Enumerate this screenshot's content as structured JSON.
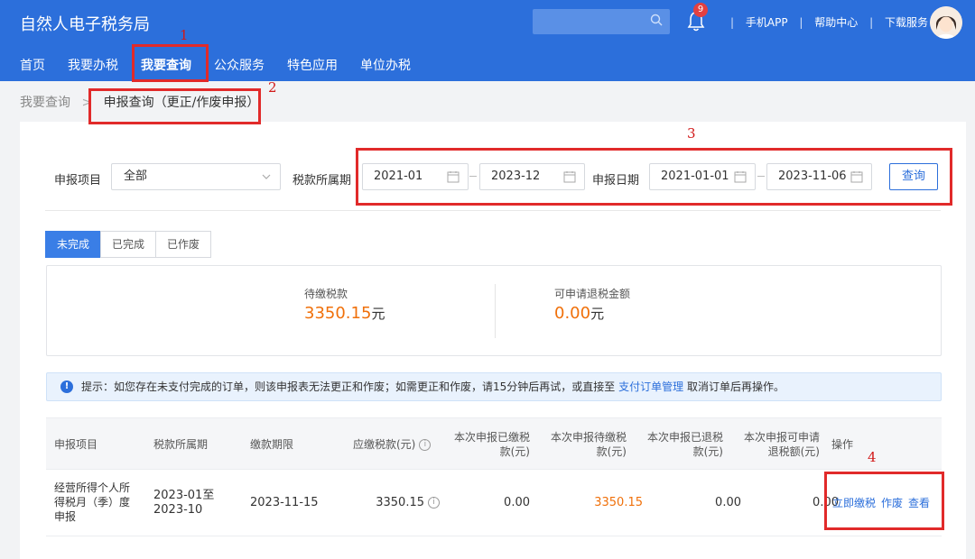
{
  "header": {
    "title": "自然人电子税务局",
    "notification_count": "9",
    "links": [
      "手机APP",
      "帮助中心",
      "下载服务"
    ]
  },
  "nav": {
    "items": [
      "首页",
      "我要办税",
      "我要查询",
      "公众服务",
      "特色应用",
      "单位办税"
    ],
    "active_index": 2
  },
  "breadcrumb": {
    "parent": "我要查询",
    "current": "申报查询（更正/作废申报）"
  },
  "filters": {
    "item_label": "申报项目",
    "item_value": "全部",
    "period_label": "税款所属期",
    "period_start": "2021-01",
    "period_end": "2023-12",
    "date_label": "申报日期",
    "date_start": "2021-01-01",
    "date_end": "2023-11-06",
    "query_button": "查询"
  },
  "tabs": [
    "未完成",
    "已完成",
    "已作废"
  ],
  "summary": {
    "pending_label": "待缴税款",
    "pending_value": "3350.15",
    "pending_unit": "元",
    "refund_label": "可申请退税金额",
    "refund_value": "0.00",
    "refund_unit": "元"
  },
  "notice": {
    "text_before": "提示：如您存在未支付完成的订单，则该申报表无法更正和作废；如需更正和作废，请15分钟后再试，或直接至",
    "link": "支付订单管理",
    "text_after": "取消订单后再操作。"
  },
  "table": {
    "headers": {
      "item": "申报项目",
      "period": "税款所属期",
      "deadline": "缴款期限",
      "payable": "应缴税款(元)",
      "paid_line1": "本次申报已缴税",
      "paid_line2": "款(元)",
      "pending_line1": "本次申报待缴税",
      "pending_line2": "款(元)",
      "refunded_line1": "本次申报已退税",
      "refunded_line2": "款(元)",
      "refundable_line1": "本次申报可申请",
      "refundable_line2": "退税额(元)",
      "ops": "操作"
    },
    "rows": [
      {
        "item_line1": "经营所得个人所",
        "item_line2": "得税月（季）度",
        "item_line3": "申报",
        "period_line1": "2023-01至",
        "period_line2": "2023-10",
        "deadline": "2023-11-15",
        "payable": "3350.15",
        "paid": "0.00",
        "pending": "3350.15",
        "refunded": "0.00",
        "refundable": "0.00",
        "ops": [
          "立即缴税",
          "作废",
          "查看"
        ]
      }
    ]
  },
  "annotations": [
    "1",
    "2",
    "3",
    "4"
  ]
}
